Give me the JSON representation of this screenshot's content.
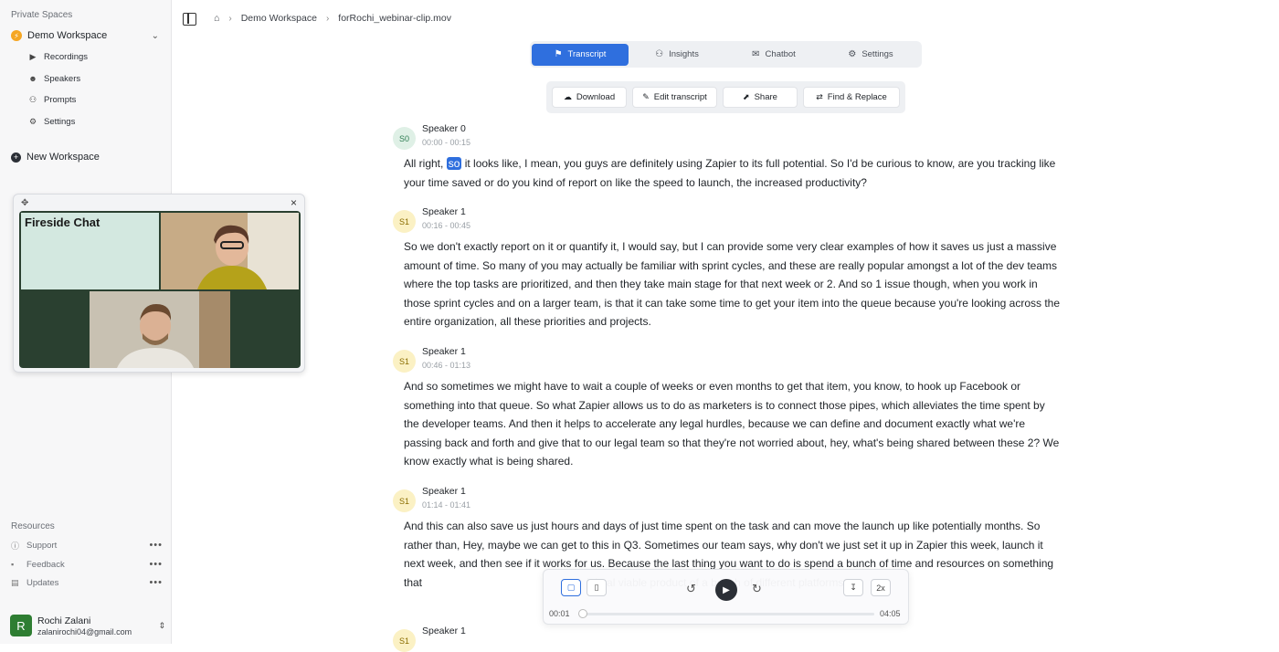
{
  "sidebar": {
    "private_spaces_label": "Private Spaces",
    "workspace": {
      "name": "Demo Workspace",
      "badge": "⚡"
    },
    "items": [
      {
        "label": "Recordings",
        "icon": "recordings-icon",
        "glyph": "▶"
      },
      {
        "label": "Speakers",
        "icon": "speakers-icon",
        "glyph": "☻"
      },
      {
        "label": "Prompts",
        "icon": "prompts-icon",
        "glyph": "⚇"
      },
      {
        "label": "Settings",
        "icon": "gear-icon",
        "glyph": "⚙"
      }
    ],
    "new_workspace": "New Workspace",
    "resources_label": "Resources",
    "resources": [
      {
        "label": "Support",
        "glyph": "ⓘ"
      },
      {
        "label": "Feedback",
        "glyph": "▪"
      },
      {
        "label": "Updates",
        "glyph": "▤"
      }
    ],
    "user": {
      "initial": "R",
      "name": "Rochi Zalani",
      "email": "zalanirochi04@gmail.com"
    }
  },
  "video_popup": {
    "tile_title": "Fireside Chat"
  },
  "breadcrumb": {
    "workspace": "Demo Workspace",
    "file": "forRochi_webinar-clip.mov"
  },
  "tabs": [
    {
      "label": "Transcript",
      "active": true,
      "glyph": "⚑"
    },
    {
      "label": "Insights",
      "active": false,
      "glyph": "⚇"
    },
    {
      "label": "Chatbot",
      "active": false,
      "glyph": "✉"
    },
    {
      "label": "Settings",
      "active": false,
      "glyph": "⚙"
    }
  ],
  "actions": [
    {
      "label": "Download",
      "glyph": "☁"
    },
    {
      "label": "Edit transcript",
      "glyph": "✎"
    },
    {
      "label": "Share",
      "glyph": "⬈"
    },
    {
      "label": "Find & Replace",
      "glyph": "⇄"
    }
  ],
  "segments": [
    {
      "badge": "S0",
      "speaker": "Speaker 0",
      "time": "00:00 - 00:15",
      "pre": "All right, ",
      "highlight": "so",
      "text": " it looks like, I mean, you guys are definitely using Zapier to its full potential. So I'd be curious to know, are you tracking like your time saved or do you kind of report on like the speed to launch, the increased productivity?"
    },
    {
      "badge": "S1",
      "speaker": "Speaker 1",
      "time": "00:16 - 00:45",
      "text": "So we don't exactly report on it or quantify it, I would say, but I can provide some very clear examples of how it saves us just a massive amount of time. So many of you may actually be familiar with sprint cycles, and these are really popular amongst a lot of the dev teams where the top tasks are prioritized, and then they take main stage for that next week or 2. And so 1 issue though, when you work in those sprint cycles and on a larger team, is that it can take some time to get your item into the queue because you're looking across the entire organization, all these priorities and projects."
    },
    {
      "badge": "S1",
      "speaker": "Speaker 1",
      "time": "00:46 - 01:13",
      "text": "And so sometimes we might have to wait a couple of weeks or even months to get that item, you know, to hook up Facebook or something into that queue. So what Zapier allows us to do as marketers is to connect those pipes, which alleviates the time spent by the developer teams. And then it helps to accelerate any legal hurdles, because we can define and document exactly what we're passing back and forth and give that to our legal team so that they're not worried about, hey, what's being shared between these 2? We know exactly what is being shared."
    },
    {
      "badge": "S1",
      "speaker": "Speaker 1",
      "time": "01:14 - 01:41",
      "text": "And this can also save us just hours and days of just time spent on the task and can move the launch up like potentially months. So rather than, Hey, maybe we can get to this in Q3. Sometimes our team says, why don't we just set it up in Zapier this week, launch it next week, and then see if it works for us. Because the last thing you want to do is spend a bunch of time and resources on something that                                                      inimal viable product of a bunch of different platforms"
    },
    {
      "badge": "S1",
      "speaker": "Speaker 1",
      "time": ""
    }
  ],
  "player": {
    "current": "00:01",
    "duration": "04:05",
    "speed": "2x",
    "progress": 0.004,
    "video_icon": "video-icon",
    "play_glyph": "▶"
  }
}
